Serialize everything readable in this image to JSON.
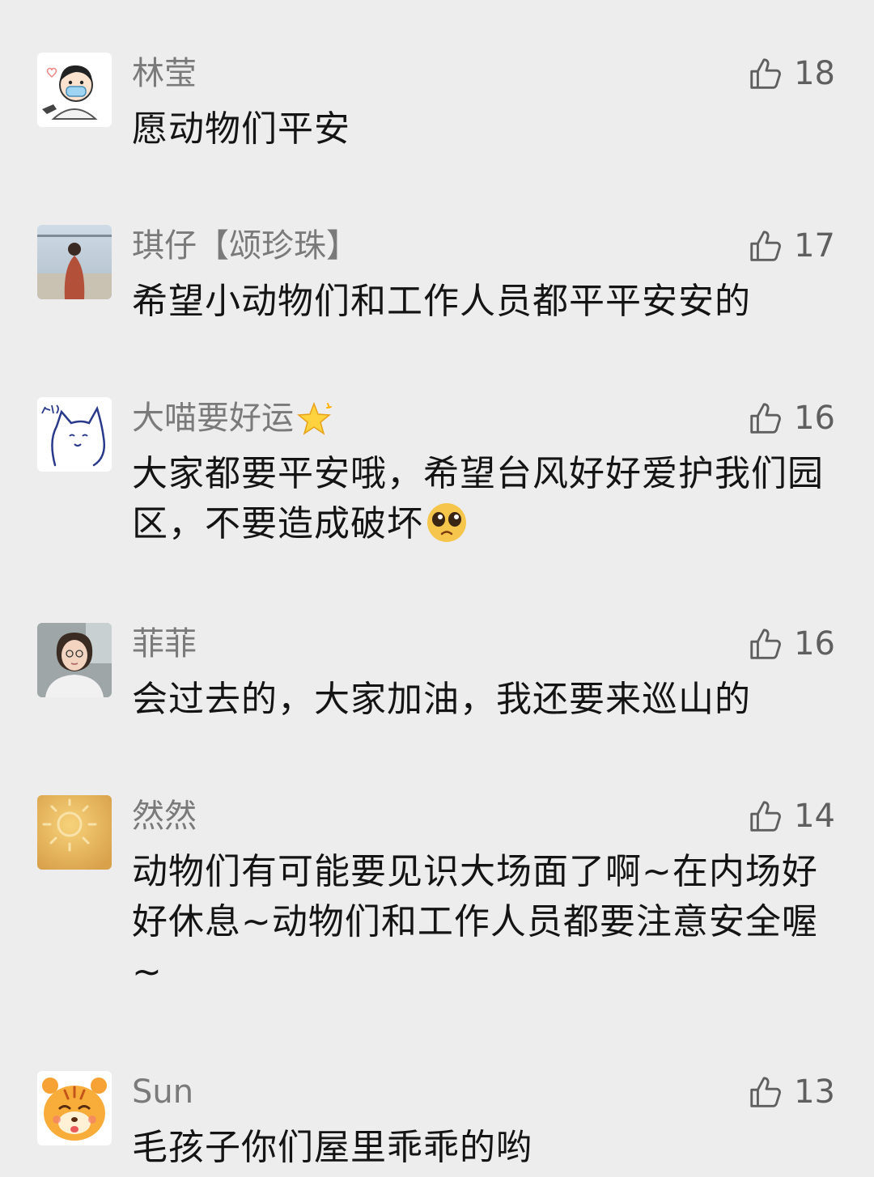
{
  "comments": [
    {
      "nickname": "林莹",
      "likes": "18",
      "text": "愿动物们平安",
      "avatar_icon": "doctor-cartoon-avatar"
    },
    {
      "nickname": "琪仔【颂珍珠】",
      "likes": "17",
      "text": "希望小动物们和工作人员都平平安安的",
      "avatar_icon": "lakeside-photo-avatar"
    },
    {
      "nickname": "大喵要好运",
      "nickname_emoji": "sparkle-star-emoji",
      "likes": "16",
      "text": "大家都要平安哦，希望台风好好爱护我们园区，不要造成破坏",
      "text_emoji": "pleading-face-emoji",
      "avatar_icon": "cat-doodle-avatar"
    },
    {
      "nickname": "菲菲",
      "likes": "16",
      "text": "会过去的，大家加油，我还要来巡山的",
      "avatar_icon": "selfie-photo-avatar"
    },
    {
      "nickname": "然然",
      "likes": "14",
      "text": "动物们有可能要见识大场面了啊~在内场好好休息~动物们和工作人员都要注意安全喔~",
      "avatar_icon": "golden-sun-avatar"
    },
    {
      "nickname": "Sun",
      "likes": "13",
      "text": "毛孩子你们屋里乖乖的哟",
      "avatar_icon": "tiger-cartoon-avatar"
    }
  ],
  "colors": {
    "background": "#ededed",
    "nickname": "#7a7a7a",
    "text": "#141414",
    "like": "#5f5f5f"
  }
}
